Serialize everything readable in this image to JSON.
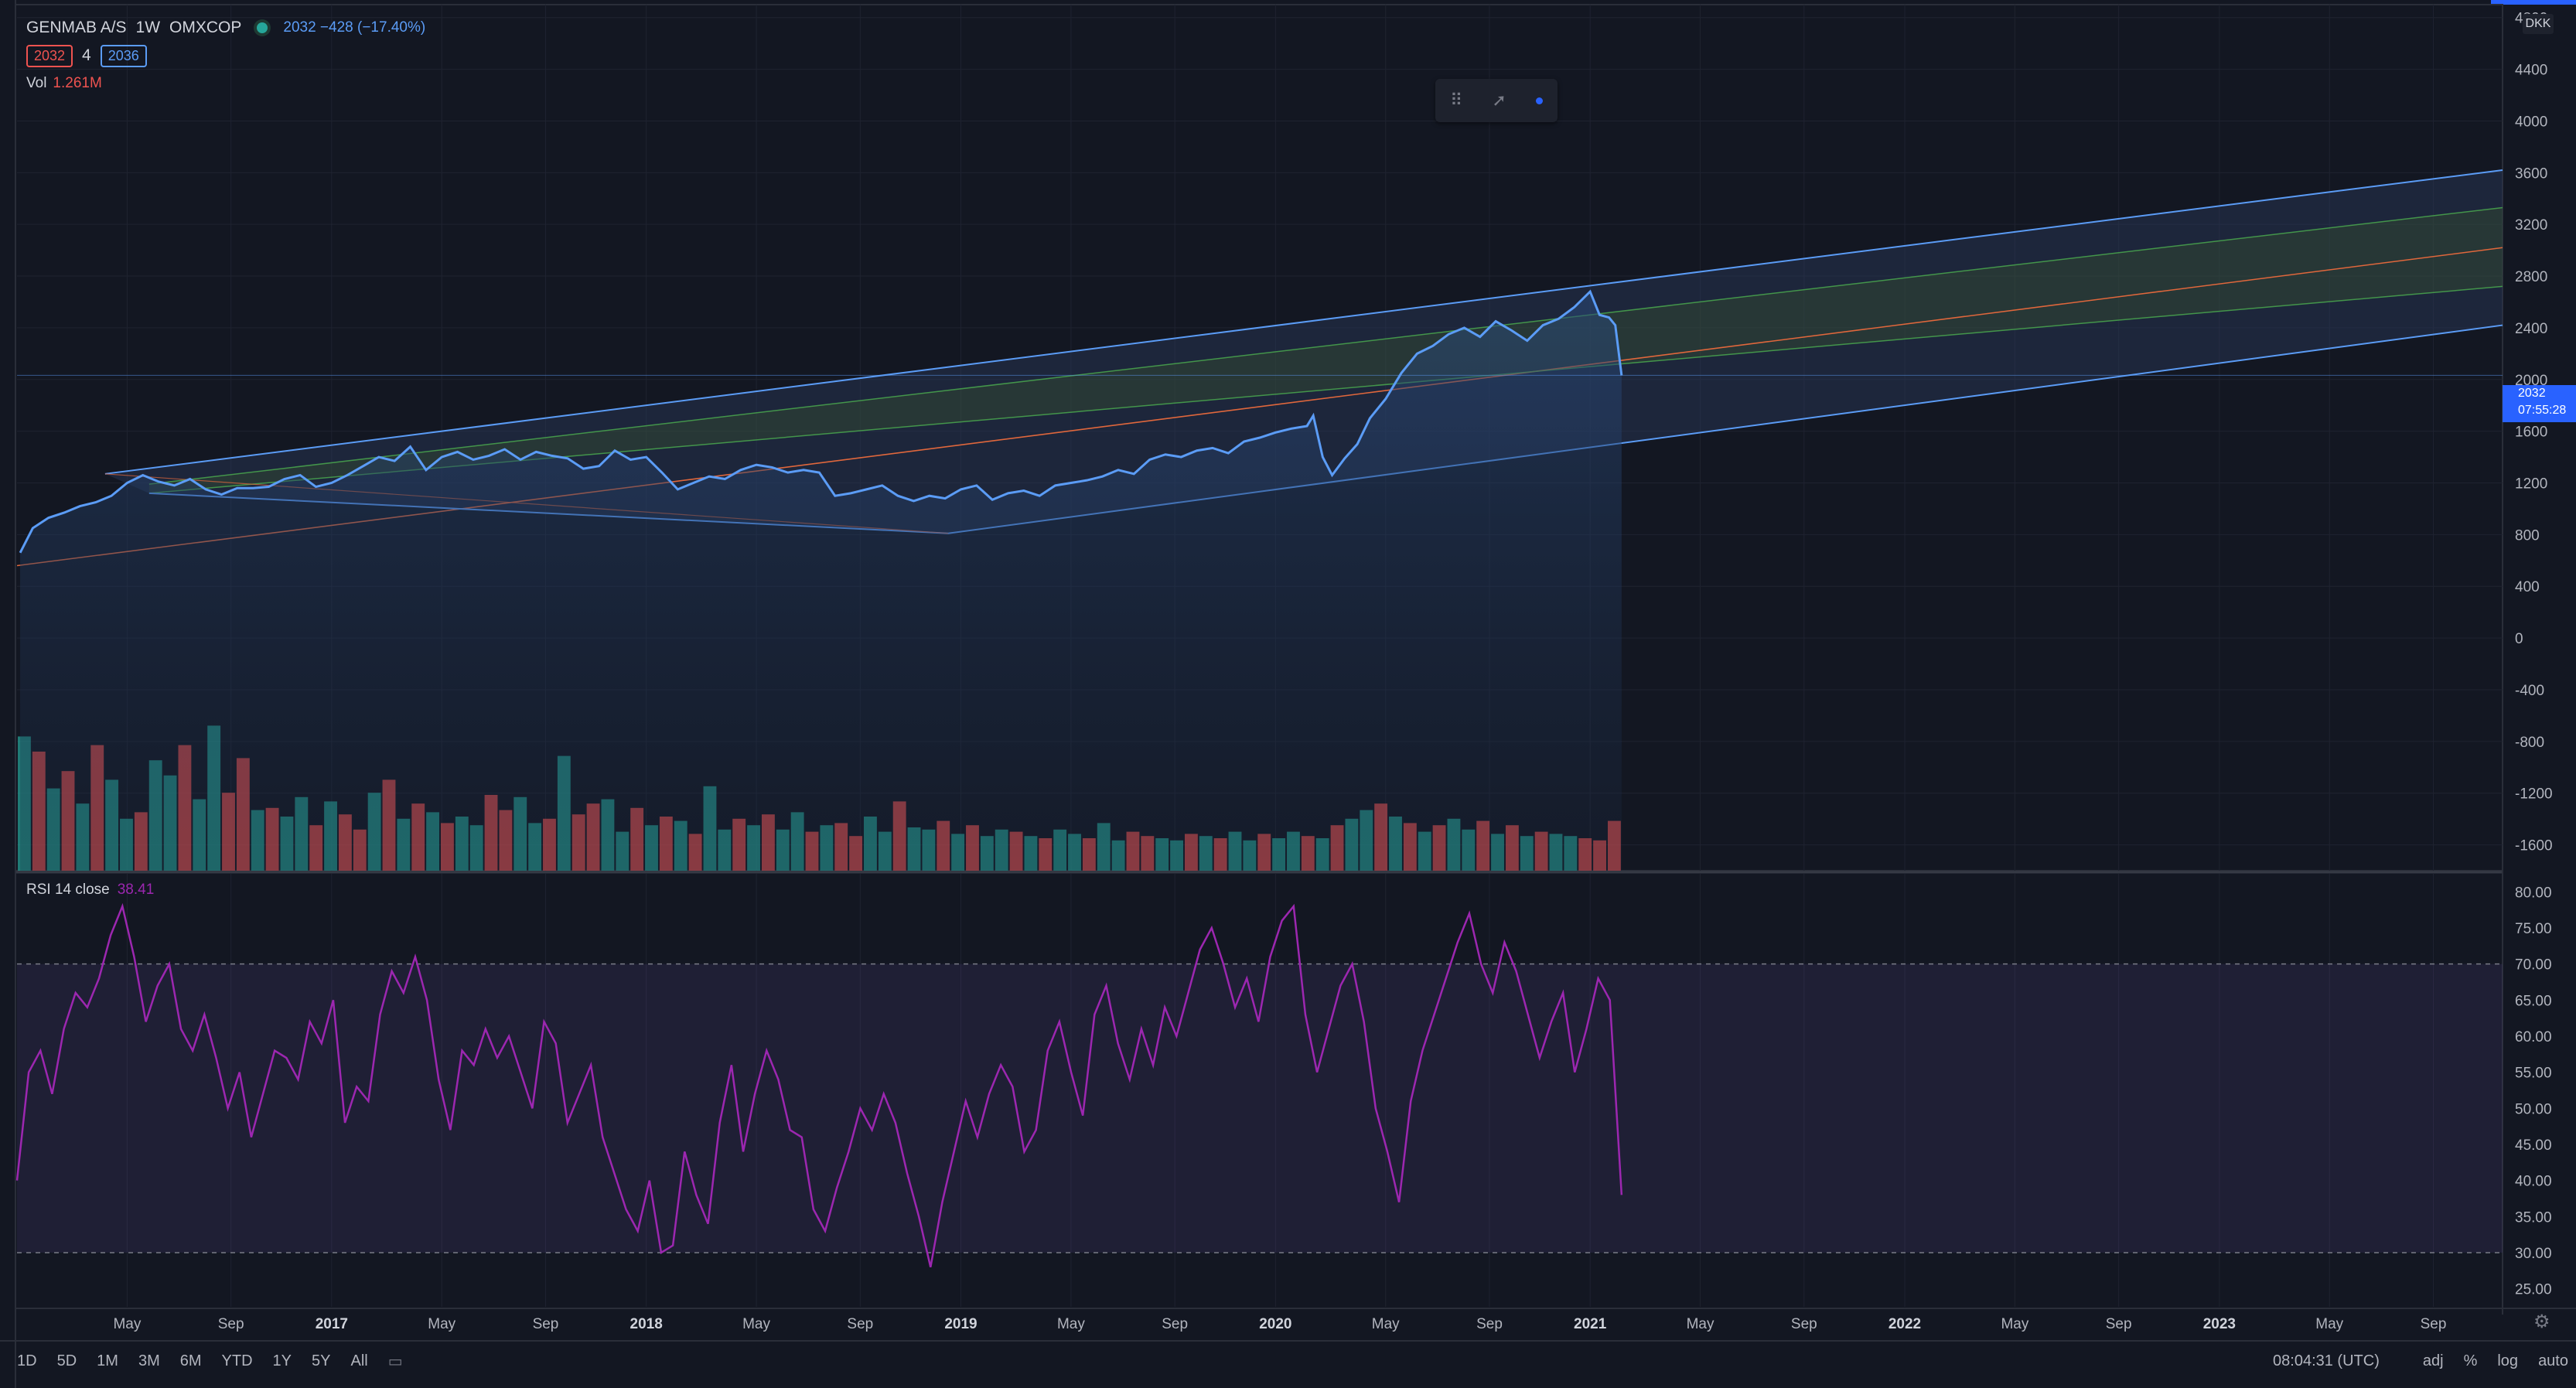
{
  "header": {
    "symbol": "GENMAB A/S",
    "interval": "1W",
    "exchange": "OMXCOP",
    "last_change": "2032 −428 (−17.40%)",
    "bid": "2032",
    "spread": "4",
    "ask": "2036",
    "volume_label": "Vol",
    "volume_value": "1.261M"
  },
  "rsi_legend": {
    "label": "RSI 14 close",
    "value": "38.41"
  },
  "price_axis": {
    "currency": "DKK",
    "last_price": "2032",
    "countdown": "07:55:28"
  },
  "bottom_bar": {
    "ranges": [
      "1D",
      "5D",
      "1M",
      "3M",
      "6M",
      "YTD",
      "1Y",
      "5Y",
      "All"
    ],
    "clock": "08:04:31 (UTC)",
    "adj": "adj",
    "percent": "%",
    "log": "log",
    "auto": "auto"
  },
  "colors": {
    "background": "#131722",
    "price_line": "#5b9cf6",
    "channel": "#5b9cf6",
    "channel_fill": "#2a3a5c",
    "inner_band": "#4caf50",
    "median": "#e0673c",
    "rsi": "#9c27b0",
    "vol_up": "#26a69a",
    "vol_down": "#ef5350"
  },
  "chart_data": [
    {
      "type": "line",
      "title": "GENMAB A/S · 1W · OMXCOP",
      "ylabel": "DKK",
      "ylim": [
        -1800,
        4900
      ],
      "y_ticks": [
        4800,
        4400,
        4000,
        3600,
        3200,
        2800,
        2400,
        2000,
        1600,
        1200,
        800,
        400,
        0,
        -400,
        -800,
        -1200,
        -1600
      ],
      "x_ticks": [
        "May",
        "Sep",
        "2017",
        "May",
        "Sep",
        "2018",
        "May",
        "Sep",
        "2019",
        "May",
        "Sep",
        "2020",
        "May",
        "Sep",
        "2021",
        "May",
        "Sep",
        "2022",
        "May",
        "Sep",
        "2023",
        "May",
        "Sep"
      ],
      "x_tick_years": [
        2016.35,
        2016.68,
        2017.0,
        2017.35,
        2017.68,
        2018.0,
        2018.35,
        2018.68,
        2019.0,
        2019.35,
        2019.68,
        2020.0,
        2020.35,
        2020.68,
        2021.0,
        2021.35,
        2021.68,
        2022.0,
        2022.35,
        2022.68,
        2023.0,
        2023.35,
        2023.68
      ],
      "x_range": [
        2016.0,
        2023.9
      ],
      "series": [
        {
          "name": "GENMAB A/S",
          "points": [
            [
              2016.01,
              660
            ],
            [
              2016.05,
              850
            ],
            [
              2016.1,
              930
            ],
            [
              2016.15,
              970
            ],
            [
              2016.2,
              1020
            ],
            [
              2016.25,
              1050
            ],
            [
              2016.3,
              1100
            ],
            [
              2016.35,
              1200
            ],
            [
              2016.4,
              1260
            ],
            [
              2016.45,
              1210
            ],
            [
              2016.5,
              1180
            ],
            [
              2016.55,
              1230
            ],
            [
              2016.6,
              1150
            ],
            [
              2016.65,
              1110
            ],
            [
              2016.7,
              1160
            ],
            [
              2016.75,
              1160
            ],
            [
              2016.8,
              1170
            ],
            [
              2016.85,
              1230
            ],
            [
              2016.9,
              1260
            ],
            [
              2016.95,
              1170
            ],
            [
              2017.0,
              1200
            ],
            [
              2017.05,
              1260
            ],
            [
              2017.1,
              1330
            ],
            [
              2017.15,
              1400
            ],
            [
              2017.2,
              1370
            ],
            [
              2017.25,
              1480
            ],
            [
              2017.3,
              1300
            ],
            [
              2017.35,
              1400
            ],
            [
              2017.4,
              1440
            ],
            [
              2017.45,
              1380
            ],
            [
              2017.5,
              1410
            ],
            [
              2017.55,
              1460
            ],
            [
              2017.6,
              1380
            ],
            [
              2017.65,
              1440
            ],
            [
              2017.7,
              1410
            ],
            [
              2017.75,
              1390
            ],
            [
              2017.8,
              1310
            ],
            [
              2017.85,
              1330
            ],
            [
              2017.9,
              1450
            ],
            [
              2017.95,
              1380
            ],
            [
              2018.0,
              1400
            ],
            [
              2018.05,
              1280
            ],
            [
              2018.1,
              1150
            ],
            [
              2018.15,
              1200
            ],
            [
              2018.2,
              1250
            ],
            [
              2018.25,
              1230
            ],
            [
              2018.3,
              1300
            ],
            [
              2018.35,
              1340
            ],
            [
              2018.4,
              1320
            ],
            [
              2018.45,
              1280
            ],
            [
              2018.5,
              1300
            ],
            [
              2018.55,
              1280
            ],
            [
              2018.6,
              1100
            ],
            [
              2018.65,
              1120
            ],
            [
              2018.7,
              1150
            ],
            [
              2018.75,
              1180
            ],
            [
              2018.8,
              1100
            ],
            [
              2018.85,
              1060
            ],
            [
              2018.9,
              1100
            ],
            [
              2018.95,
              1080
            ],
            [
              2019.0,
              1150
            ],
            [
              2019.05,
              1180
            ],
            [
              2019.1,
              1070
            ],
            [
              2019.15,
              1120
            ],
            [
              2019.2,
              1140
            ],
            [
              2019.25,
              1100
            ],
            [
              2019.3,
              1180
            ],
            [
              2019.35,
              1200
            ],
            [
              2019.4,
              1220
            ],
            [
              2019.45,
              1250
            ],
            [
              2019.5,
              1300
            ],
            [
              2019.55,
              1270
            ],
            [
              2019.6,
              1380
            ],
            [
              2019.65,
              1420
            ],
            [
              2019.7,
              1400
            ],
            [
              2019.75,
              1450
            ],
            [
              2019.8,
              1470
            ],
            [
              2019.85,
              1430
            ],
            [
              2019.9,
              1520
            ],
            [
              2019.95,
              1550
            ],
            [
              2020.0,
              1590
            ],
            [
              2020.05,
              1620
            ],
            [
              2020.1,
              1640
            ],
            [
              2020.12,
              1720
            ],
            [
              2020.15,
              1400
            ],
            [
              2020.18,
              1260
            ],
            [
              2020.22,
              1390
            ],
            [
              2020.26,
              1500
            ],
            [
              2020.3,
              1700
            ],
            [
              2020.35,
              1850
            ],
            [
              2020.4,
              2050
            ],
            [
              2020.45,
              2200
            ],
            [
              2020.5,
              2260
            ],
            [
              2020.55,
              2350
            ],
            [
              2020.6,
              2400
            ],
            [
              2020.65,
              2330
            ],
            [
              2020.7,
              2450
            ],
            [
              2020.75,
              2380
            ],
            [
              2020.8,
              2300
            ],
            [
              2020.85,
              2420
            ],
            [
              2020.9,
              2470
            ],
            [
              2020.95,
              2560
            ],
            [
              2021.0,
              2680
            ],
            [
              2021.03,
              2500
            ],
            [
              2021.06,
              2480
            ],
            [
              2021.08,
              2420
            ],
            [
              2021.1,
              2032
            ]
          ]
        },
        {
          "name": "Volume",
          "note": "weekly volume bars, relative to max 1.0",
          "values": [
            0.62,
            0.55,
            0.38,
            0.46,
            0.31,
            0.58,
            0.42,
            0.24,
            0.27,
            0.51,
            0.44,
            0.58,
            0.33,
            0.67,
            0.36,
            0.52,
            0.28,
            0.29,
            0.25,
            0.34,
            0.21,
            0.32,
            0.26,
            0.19,
            0.36,
            0.42,
            0.24,
            0.31,
            0.27,
            0.22,
            0.25,
            0.21,
            0.35,
            0.28,
            0.34,
            0.22,
            0.24,
            0.53,
            0.26,
            0.31,
            0.33,
            0.18,
            0.29,
            0.21,
            0.25,
            0.23,
            0.17,
            0.39,
            0.19,
            0.24,
            0.21,
            0.26,
            0.19,
            0.27,
            0.18,
            0.21,
            0.22,
            0.16,
            0.25,
            0.18,
            0.32,
            0.2,
            0.19,
            0.23,
            0.17,
            0.21,
            0.16,
            0.19,
            0.18,
            0.16,
            0.15,
            0.19,
            0.17,
            0.15,
            0.22,
            0.14,
            0.18,
            0.16,
            0.15,
            0.14,
            0.17,
            0.16,
            0.15,
            0.18,
            0.14,
            0.17,
            0.15,
            0.18,
            0.16,
            0.15,
            0.21,
            0.24,
            0.28,
            0.31,
            0.25,
            0.22,
            0.18,
            0.21,
            0.24,
            0.19,
            0.23,
            0.17,
            0.21,
            0.16,
            0.18,
            0.17,
            0.16,
            0.15,
            0.14,
            0.23
          ],
          "up": [
            true,
            false,
            true,
            false,
            true,
            false,
            true,
            true,
            false,
            true,
            true,
            false,
            true,
            true,
            false,
            false,
            true,
            false,
            true,
            true,
            false,
            true,
            false,
            false,
            true,
            false,
            true,
            false,
            true,
            false,
            true,
            true,
            false,
            false,
            true,
            true,
            false,
            true,
            false,
            false,
            true,
            true,
            false,
            true,
            false,
            true,
            false,
            true,
            true,
            false,
            true,
            false,
            true,
            true,
            false,
            true,
            false,
            false,
            true,
            true,
            false,
            true,
            true,
            false,
            true,
            false,
            true,
            true,
            false,
            true,
            false,
            true,
            true,
            false,
            true,
            true,
            false,
            false,
            true,
            true,
            false,
            true,
            false,
            true,
            true,
            false,
            true,
            true,
            false,
            true,
            false,
            true,
            true,
            false,
            true,
            false,
            true,
            false,
            true,
            true,
            false,
            true,
            false,
            true,
            false,
            true,
            true,
            false,
            false
          ]
        }
      ],
      "annotations": {
        "regression_channel": {
          "x_start": 2016.28,
          "x_start_low": 2016.42,
          "x_pivot": 2018.96,
          "x_end": 2023.9,
          "upper_start": 1270,
          "upper_end": 3620,
          "inner_upper_start": 1190,
          "inner_upper_end": 3330,
          "median_start": 560,
          "median_end": 3020,
          "inner_lower_start": 1120,
          "inner_lower_end": 2720,
          "lower_start": 810,
          "lower_end": 2420
        }
      }
    },
    {
      "type": "line",
      "title": "RSI 14 close",
      "ylim": [
        22.5,
        82.5
      ],
      "y_ticks": [
        80.0,
        75.0,
        70.0,
        65.0,
        60.0,
        55.0,
        50.0,
        45.0,
        40.0,
        35.0,
        30.0,
        25.0
      ],
      "y_tick_labels": [
        "80.00",
        "75.00",
        "70.00",
        "65.00",
        "60.00",
        "55.00",
        "50.00",
        "45.00",
        "40.00",
        "35.00",
        "30.00",
        "25.00"
      ],
      "bands": [
        30,
        70
      ],
      "series": [
        {
          "name": "RSI",
          "x_range": [
            2016.0,
            2021.1
          ],
          "values": [
            40,
            55,
            58,
            52,
            61,
            66,
            64,
            68,
            74,
            78,
            71,
            62,
            67,
            70,
            61,
            58,
            63,
            57,
            50,
            55,
            46,
            52,
            58,
            57,
            54,
            62,
            59,
            65,
            48,
            53,
            51,
            63,
            69,
            66,
            71,
            65,
            54,
            47,
            58,
            56,
            61,
            57,
            60,
            55,
            50,
            62,
            59,
            48,
            52,
            56,
            46,
            41,
            36,
            33,
            40,
            30,
            31,
            44,
            38,
            34,
            48,
            56,
            44,
            52,
            58,
            54,
            47,
            46,
            36,
            33,
            39,
            44,
            50,
            47,
            52,
            48,
            41,
            35,
            28,
            37,
            44,
            51,
            46,
            52,
            56,
            53,
            44,
            47,
            58,
            62,
            55,
            49,
            63,
            67,
            59,
            54,
            61,
            56,
            64,
            60,
            66,
            72,
            75,
            70,
            64,
            68,
            62,
            71,
            76,
            78,
            63,
            55,
            61,
            67,
            70,
            62,
            50,
            44,
            37,
            51,
            58,
            63,
            68,
            73,
            77,
            70,
            66,
            73,
            69,
            63,
            57,
            62,
            66,
            55,
            61,
            68,
            65,
            38
          ]
        }
      ]
    }
  ]
}
